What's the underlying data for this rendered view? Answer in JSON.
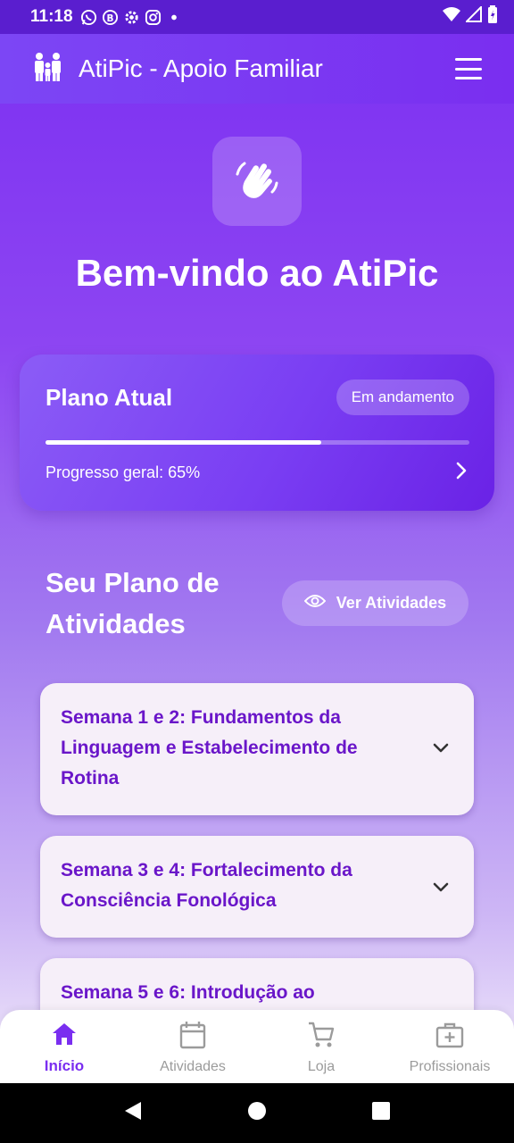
{
  "status_bar": {
    "time": "11:18",
    "icons_left": [
      "whatsapp-icon",
      "b-app-icon",
      "settings-icon",
      "instagram-icon",
      "dot-icon"
    ],
    "icons_right": [
      "wifi-icon",
      "signal-icon",
      "battery-icon"
    ]
  },
  "app_bar": {
    "title": "AtiPic - Apoio Familiar",
    "logo_icon": "family-icon",
    "menu_icon": "hamburger-menu-icon"
  },
  "hero": {
    "icon": "waving-hand-icon",
    "welcome": "Bem-vindo ao AtiPic"
  },
  "plan_card": {
    "title": "Plano Atual",
    "status_badge": "Em andamento",
    "progress_label": "Progresso geral: 65%",
    "progress_fraction": 0.65
  },
  "activities_section": {
    "title": "Seu Plano de Atividades",
    "view_button": "Ver Atividades"
  },
  "weeks": [
    {
      "label": "Semana 1 e 2: Fundamentos da Linguagem e Estabelecimento de Rotina"
    },
    {
      "label": "Semana 3 e 4: Fortalecimento da Consciência Fonológica"
    },
    {
      "label": "Semana 5 e 6: Introdução ao"
    }
  ],
  "bottom_nav": {
    "items": [
      {
        "label": "Início",
        "icon": "home-icon",
        "active": true
      },
      {
        "label": "Atividades",
        "icon": "calendar-icon",
        "active": false
      },
      {
        "label": "Loja",
        "icon": "cart-icon",
        "active": false
      },
      {
        "label": "Profissionais",
        "icon": "medical-kit-icon",
        "active": false
      }
    ]
  },
  "colors": {
    "primary": "#7a2ef0",
    "week_text": "#6a16c9",
    "card_bg": "#f6eff9",
    "inactive_nav": "#9b9b9b"
  }
}
